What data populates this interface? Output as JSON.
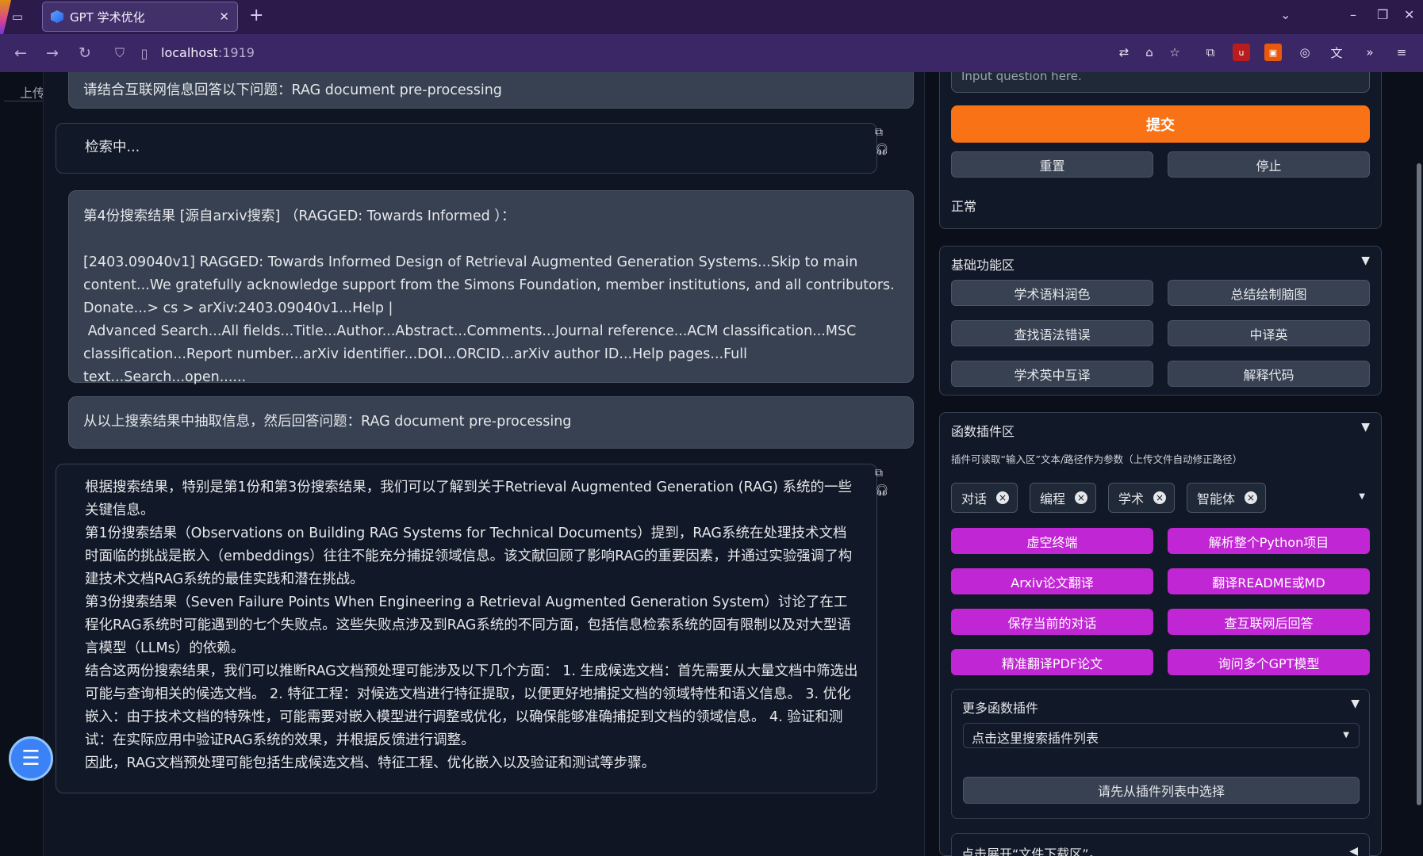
{
  "browser": {
    "tab_title": "GPT 学术优化",
    "url_host": "localhost",
    "url_port": ":1919"
  },
  "upload_label": "上传文件",
  "chat": {
    "messages": [
      {
        "role": "user",
        "text": "请结合互联网信息回答以下问题：RAG document pre-processing"
      },
      {
        "role": "bot",
        "text": "检索中..."
      },
      {
        "role": "user",
        "text": "第4份搜索结果 [源自arxiv搜索] （RAGGED: Towards Informed ）：\n\n[2403.09040v1] RAGGED: Towards Informed Design of Retrieval Augmented Generation Systems...Skip to main content...We gratefully acknowledge support from the Simons Foundation, member institutions, and all contributors. Donate...> cs > arXiv:2403.09040v1...Help | \n Advanced Search...All fields...Title...Author...Abstract...Comments...Journal reference...ACM classification...MSC classification...Report number...arXiv identifier...DOI...ORCID...arXiv author ID...Help pages...Full text...Search...open......"
      },
      {
        "role": "user",
        "text": "从以上搜索结果中抽取信息，然后回答问题：RAG document pre-processing"
      },
      {
        "role": "bot",
        "text": "根据搜索结果，特别是第1份和第3份搜索结果，我们可以了解到关于Retrieval Augmented Generation (RAG) 系统的一些关键信息。\n第1份搜索结果（Observations on Building RAG Systems for Technical Documents）提到，RAG系统在处理技术文档时面临的挑战是嵌入（embeddings）往往不能充分捕捉领域信息。该文献回顾了影响RAG的重要因素，并通过实验强调了构建技术文档RAG系统的最佳实践和潜在挑战。\n第3份搜索结果（Seven Failure Points When Engineering a Retrieval Augmented Generation System）讨论了在工程化RAG系统时可能遇到的七个失败点。这些失败点涉及到RAG系统的不同方面，包括信息检索系统的固有限制以及对大型语言模型（LLMs）的依赖。\n结合这两份搜索结果，我们可以推断RAG文档预处理可能涉及以下几个方面： 1. 生成候选文档：首先需要从大量文档中筛选出可能与查询相关的候选文档。 2. 特征工程：对候选文档进行特征提取，以便更好地捕捉文档的领域特性和语义信息。 3. 优化嵌入：由于技术文档的特殊性，可能需要对嵌入模型进行调整或优化，以确保能够准确捕捉到文档的领域信息。 4. 验证和测试：在实际应用中验证RAG系统的效果，并根据反馈进行调整。\n因此，RAG文档预处理可能包括生成候选文档、特征工程、优化嵌入以及验证和测试等步骤。"
      }
    ]
  },
  "input": {
    "placeholder": "Input question here.",
    "submit": "提交",
    "reset": "重置",
    "stop": "停止",
    "status": "正常"
  },
  "basic": {
    "title": "基础功能区",
    "buttons": [
      "学术语料润色",
      "总结绘制脑图",
      "查找语法错误",
      "中译英",
      "学术英中互译",
      "解释代码"
    ]
  },
  "plugins": {
    "title": "函数插件区",
    "hint": "插件可读取“输入区”文本/路径作为参数（上传文件自动修正路径）",
    "chips": [
      "对话",
      "编程",
      "学术",
      "智能体"
    ],
    "buttons": [
      "虚空终端",
      "解析整个Python项目",
      "Arxiv论文翻译",
      "翻译README或MD",
      "保存当前的对话",
      "查互联网后回答",
      "精准翻译PDF论文",
      "询问多个GPT模型"
    ],
    "more_title": "更多函数插件",
    "search_placeholder": "点击这里搜索插件列表",
    "select_first": "请先从插件列表中选择"
  },
  "download": {
    "title": "点击展开“文件下载区”。"
  },
  "colors": {
    "accent_orange": "#f97316",
    "plugin_purple": "#c026d3",
    "browser_purple": "#3c2766"
  }
}
